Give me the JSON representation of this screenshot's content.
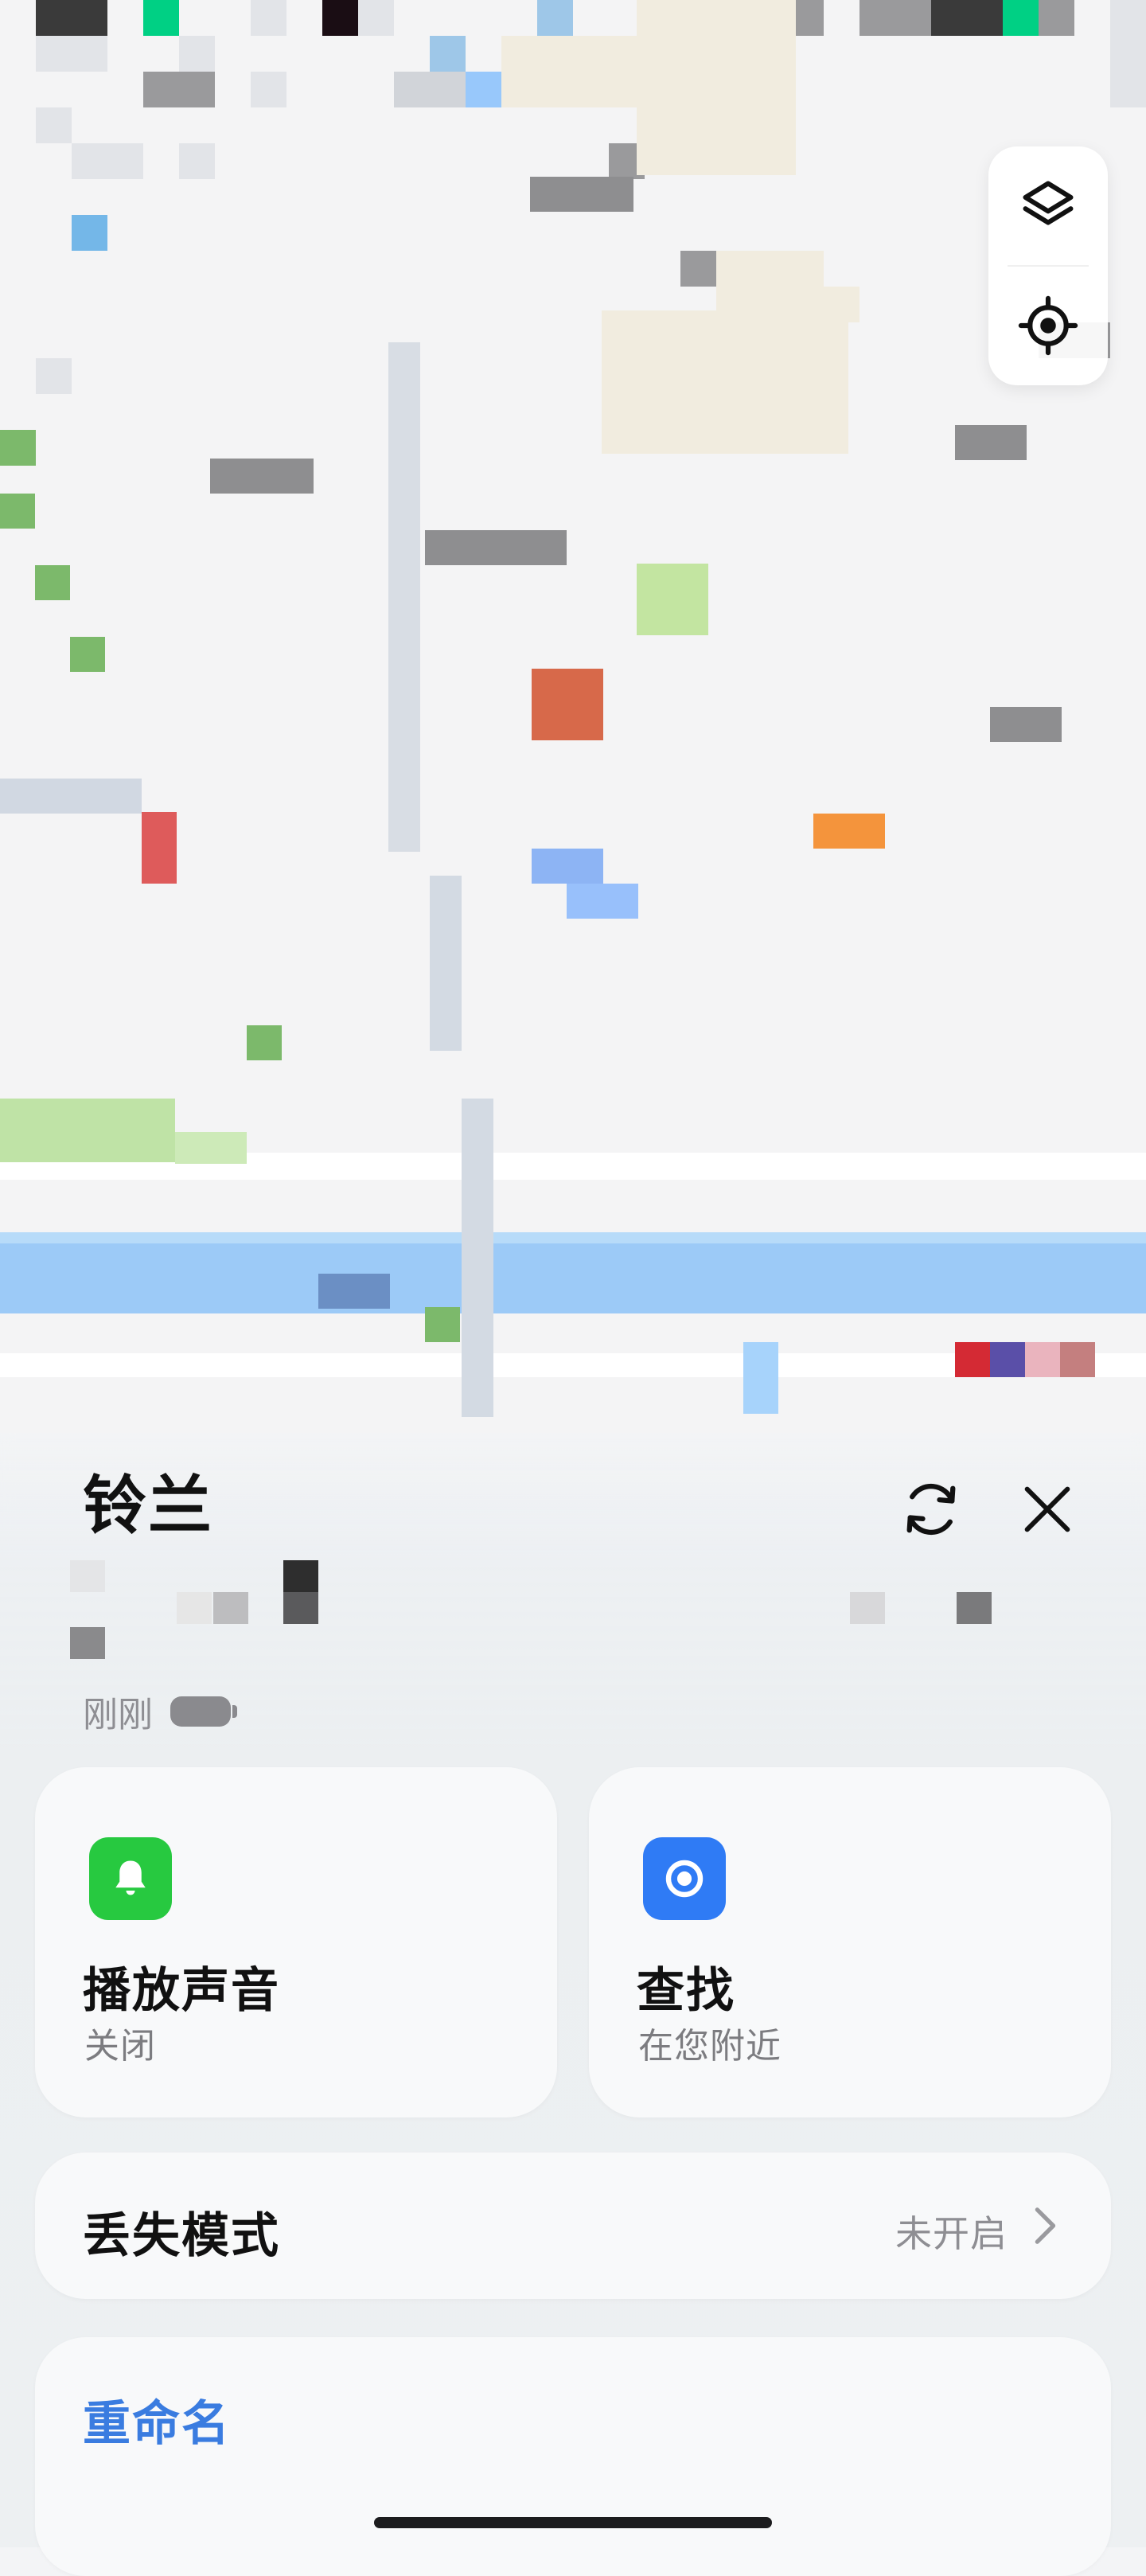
{
  "map": {
    "palette": {
      "a": "#f4f4f5",
      "b": "#ffffff",
      "c": "#e2e4e8",
      "d": "#d1d4d9",
      "e": "#c6d0dd",
      "f": "#9a9a9c",
      "g": "#6f6f72",
      "h": "#3a3a3a",
      "k": "#1a0d14",
      "m": "#00d084",
      "n": "#9ec7e8",
      "o": "#74b7e8",
      "p": "#f1ecdf",
      "q": "#7cb96b",
      "r": "#c3e5a1",
      "s": "#da6f4f",
      "t": "#e05555",
      "u": "#f4943c",
      "v": "#8db4f4",
      "w": "#98c8fb",
      "x": "#b4ddf7",
      "y": "#6b8fc4",
      "z": "#d42a34",
      "A": "#5a4fa8",
      "B": "#eab4be",
      "C": "#c47f7f",
      "D": "#ecf0ec",
      "E": "#a8d5a0"
    },
    "rows": [
      "ahhamaacakcaaaanaaphhffaffhhmfac",
      "accaacaaaaaanapppppaaaaaaaaaaaac",
      "aaaaffacaaaddwppppaaaaaaaaaaaaac",
      "acaaaaaaaaaaaaaaaaaaaaaaaaaaaaaa",
      "aaccacaaaaaaaaaaafaaaaaaaaaaaaaa",
      "aaaaaaaaaaaaaaaaaaaaaaaaaaaaaaaa",
      "aaoaaaaaaaaaaaaaaaaaaaaaaaaaaaaa",
      "aaaaaaaaaaaaaaaaaaafpppaaaaaaaaa",
      "aaaaaaaaaaaaaaaaaaaappppaaaaaaaa",
      "aaaaaaaaaaaaaaaaaaappppaaaaaaffa",
      "acaaaaaaaaaaaaaaaaaaaaaaaaaaaaaa",
      "aaaaaaaaaaaaaaaaaaaaaaaaaaaaaaaa",
      "qaaaaaaaaaaaaaaaaaaaaaaaaaaaaaaa",
      "aaaaaaaaaaaaaaaaaaaaaaaaaaaaaaaa",
      "aaaaaaaaaaaaaaaaaaaaaaaaaaaaaaaa",
      "aaaaaaaaaaaaaaaaaaaaaaaaaaaaaaaa",
      "aaaaaaaaaaaaaaaaaaaaaaaaaaaaaaaa",
      "aaaaaaaaaaaaaaaaaaaaaaaaaaaaaaaa",
      "aaaaaaaaaaaaaaaaaaaaaaaaaaaaaaaa",
      "aaaaaaaaaaaaaaaaaaaaaaaaaaaaaaaa",
      "aaaaaaaaaaaaaaaaaaaaaaaaaaaaaaaa",
      "aaaaaaaaaaaaaaaaaaaaaaaaaaaaaaaa",
      "aaaaaaaaaaaaaaaaaaaaaaaaaaaaaaaa",
      "aaaaaaaaaaaaaaaaaaaaaaaaaaaaaaaa",
      "aaaaaaaaaaaaaaaaaaaaaaaaaaaaaaaa",
      "aaaaaaaaaaaaaaaaaaaaaaaaaaaaaaaa",
      "aaaaaaaaaaaaaaaaaaaaaaaaaaaaaaaa",
      "aaaaaaaaaaaaaaaaaaaaaaaaaaaaaaaa",
      "aaaaaaaaaaaaaaaaaaaaaaaaaaaaaaaa",
      "aaaaaaaaaaaaaaaaaaaaaaaaaaaaaaaa",
      "aaaaaaaaaaaaaaaaaaaaaaaaaaaaaaaa",
      "aaaaaaaaaaaaaaaaaaaaaaaaaaaaaaaa",
      "aaaaaaaaaaaaaaaaaaaaaaaaaaaaaaaa",
      "aaaaaaaaaaaaaaaaaaaaaaaaaaaaaaaa",
      "aaaaaaaaaaaaaaaaaaaaaaaaaaaaaaaa",
      "aaaaaaaaaaaaaaaaaaaaaaaaaaaaaaaa",
      "aaaaaaaaaaaaaaaaaaaaaaaaaaaaaaaa",
      "aaaaaaaaaaaaaaaaaaaaaaaaaaaaaaaa",
      "aaaaaaaaaaaaaaaaaaaaaaaaaaaaaaaa",
      "aaaaaaaaaaaaaaaaaaaaaaaaaaaaaaaa",
      "aaaaaaaaaaaaaaaaaaaaaaaaaaaaaaaa",
      "aaaaaaaaaaaaaaaaaaaaaaaaaaaaaaaa"
    ]
  },
  "map_controls": {
    "layers_icon": "layers-icon",
    "locate_icon": "locate-icon"
  },
  "device": {
    "name": "铃兰",
    "updated": "刚刚",
    "refresh_icon": "refresh-icon",
    "close_icon": "close-icon"
  },
  "actions": {
    "sound": {
      "title": "播放声音",
      "subtitle": "关闭",
      "icon": "bell-icon",
      "color": "#27c940"
    },
    "find": {
      "title": "查找",
      "subtitle": "在您附近",
      "icon": "target-icon",
      "color": "#2f7bf5"
    }
  },
  "lost_mode": {
    "label": "丢失模式",
    "status": "未开启"
  },
  "rename": {
    "label": "重命名",
    "color": "#3a7ce0"
  }
}
